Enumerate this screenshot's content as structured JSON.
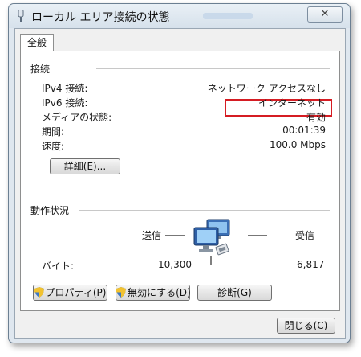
{
  "window": {
    "title": "ローカル エリア接続の状態",
    "close_label": "✕"
  },
  "tabs": [
    {
      "label": "全般"
    }
  ],
  "connection": {
    "section_label": "接続",
    "rows": [
      {
        "label": "IPv4 接続:",
        "value": "ネットワーク アクセスなし"
      },
      {
        "label": "IPv6 接続:",
        "value": "インターネット"
      },
      {
        "label": "メディアの状態:",
        "value": "有効"
      },
      {
        "label": "期間:",
        "value": "00:01:39"
      },
      {
        "label": "速度:",
        "value": "100.0 Mbps"
      }
    ],
    "details_button": "詳細(E)..."
  },
  "activity": {
    "section_label": "動作状況",
    "sent_label": "送信",
    "received_label": "受信",
    "bytes_label": "バイト:",
    "bytes_sent": "10,300",
    "bytes_received": "6,817"
  },
  "buttons": {
    "properties": "プロパティ(P)",
    "disable": "無効にする(D)",
    "diagnose": "診断(G)",
    "close": "閉じる(C)"
  },
  "colors": {
    "highlight": "#d51c23",
    "window_frame": "#dfe7ef",
    "client_bg": "#f0f0f0"
  },
  "icons": {
    "title": "network-connection-icon",
    "activity": "network-computers-icon",
    "shield": "uac-shield-icon"
  }
}
